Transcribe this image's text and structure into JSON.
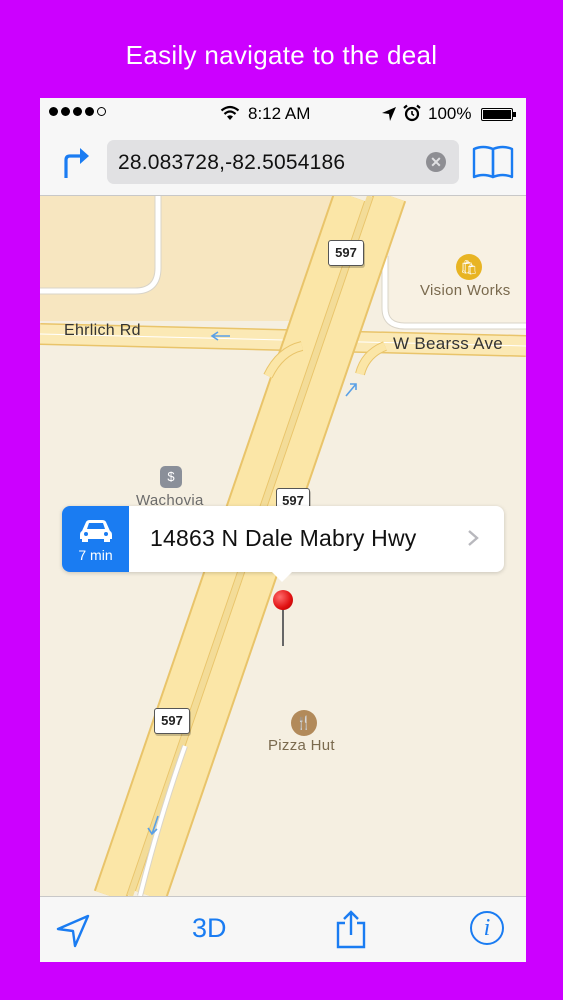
{
  "headline": "Easily navigate to the deal",
  "status_bar": {
    "time": "8:12 AM",
    "battery": "100%",
    "signal_icon": "signal-dots-icon",
    "wifi_icon": "wifi-icon",
    "location_icon": "location-arrow-icon",
    "alarm_icon": "alarm-clock-icon"
  },
  "nav_bar": {
    "search_value": "28.083728,-82.5054186",
    "directions_icon": "turn-right-arrow-icon",
    "clear_icon": "clear-x-icon",
    "bookmarks_icon": "book-icon"
  },
  "map": {
    "roads": {
      "ehrlich": "Ehrlich Rd",
      "bearss": "W Bearss Ave"
    },
    "shields": {
      "top": "597",
      "middle": "597",
      "bottom": "597"
    },
    "pois": {
      "vision_works": "Vision Works",
      "wachovia": "Wachovia",
      "pizza_hut": "Pizza Hut"
    },
    "callout": {
      "eta": "7 min",
      "address": "14863 N Dale Mabry Hwy"
    }
  },
  "toolbar": {
    "three_d": "3D",
    "info_label": "i"
  },
  "colors": {
    "background": "#cc00ff",
    "accent": "#1a7cf2",
    "road_major": "#fbe6a7",
    "road_edge": "#e9c46a",
    "pin": "#e01010"
  }
}
